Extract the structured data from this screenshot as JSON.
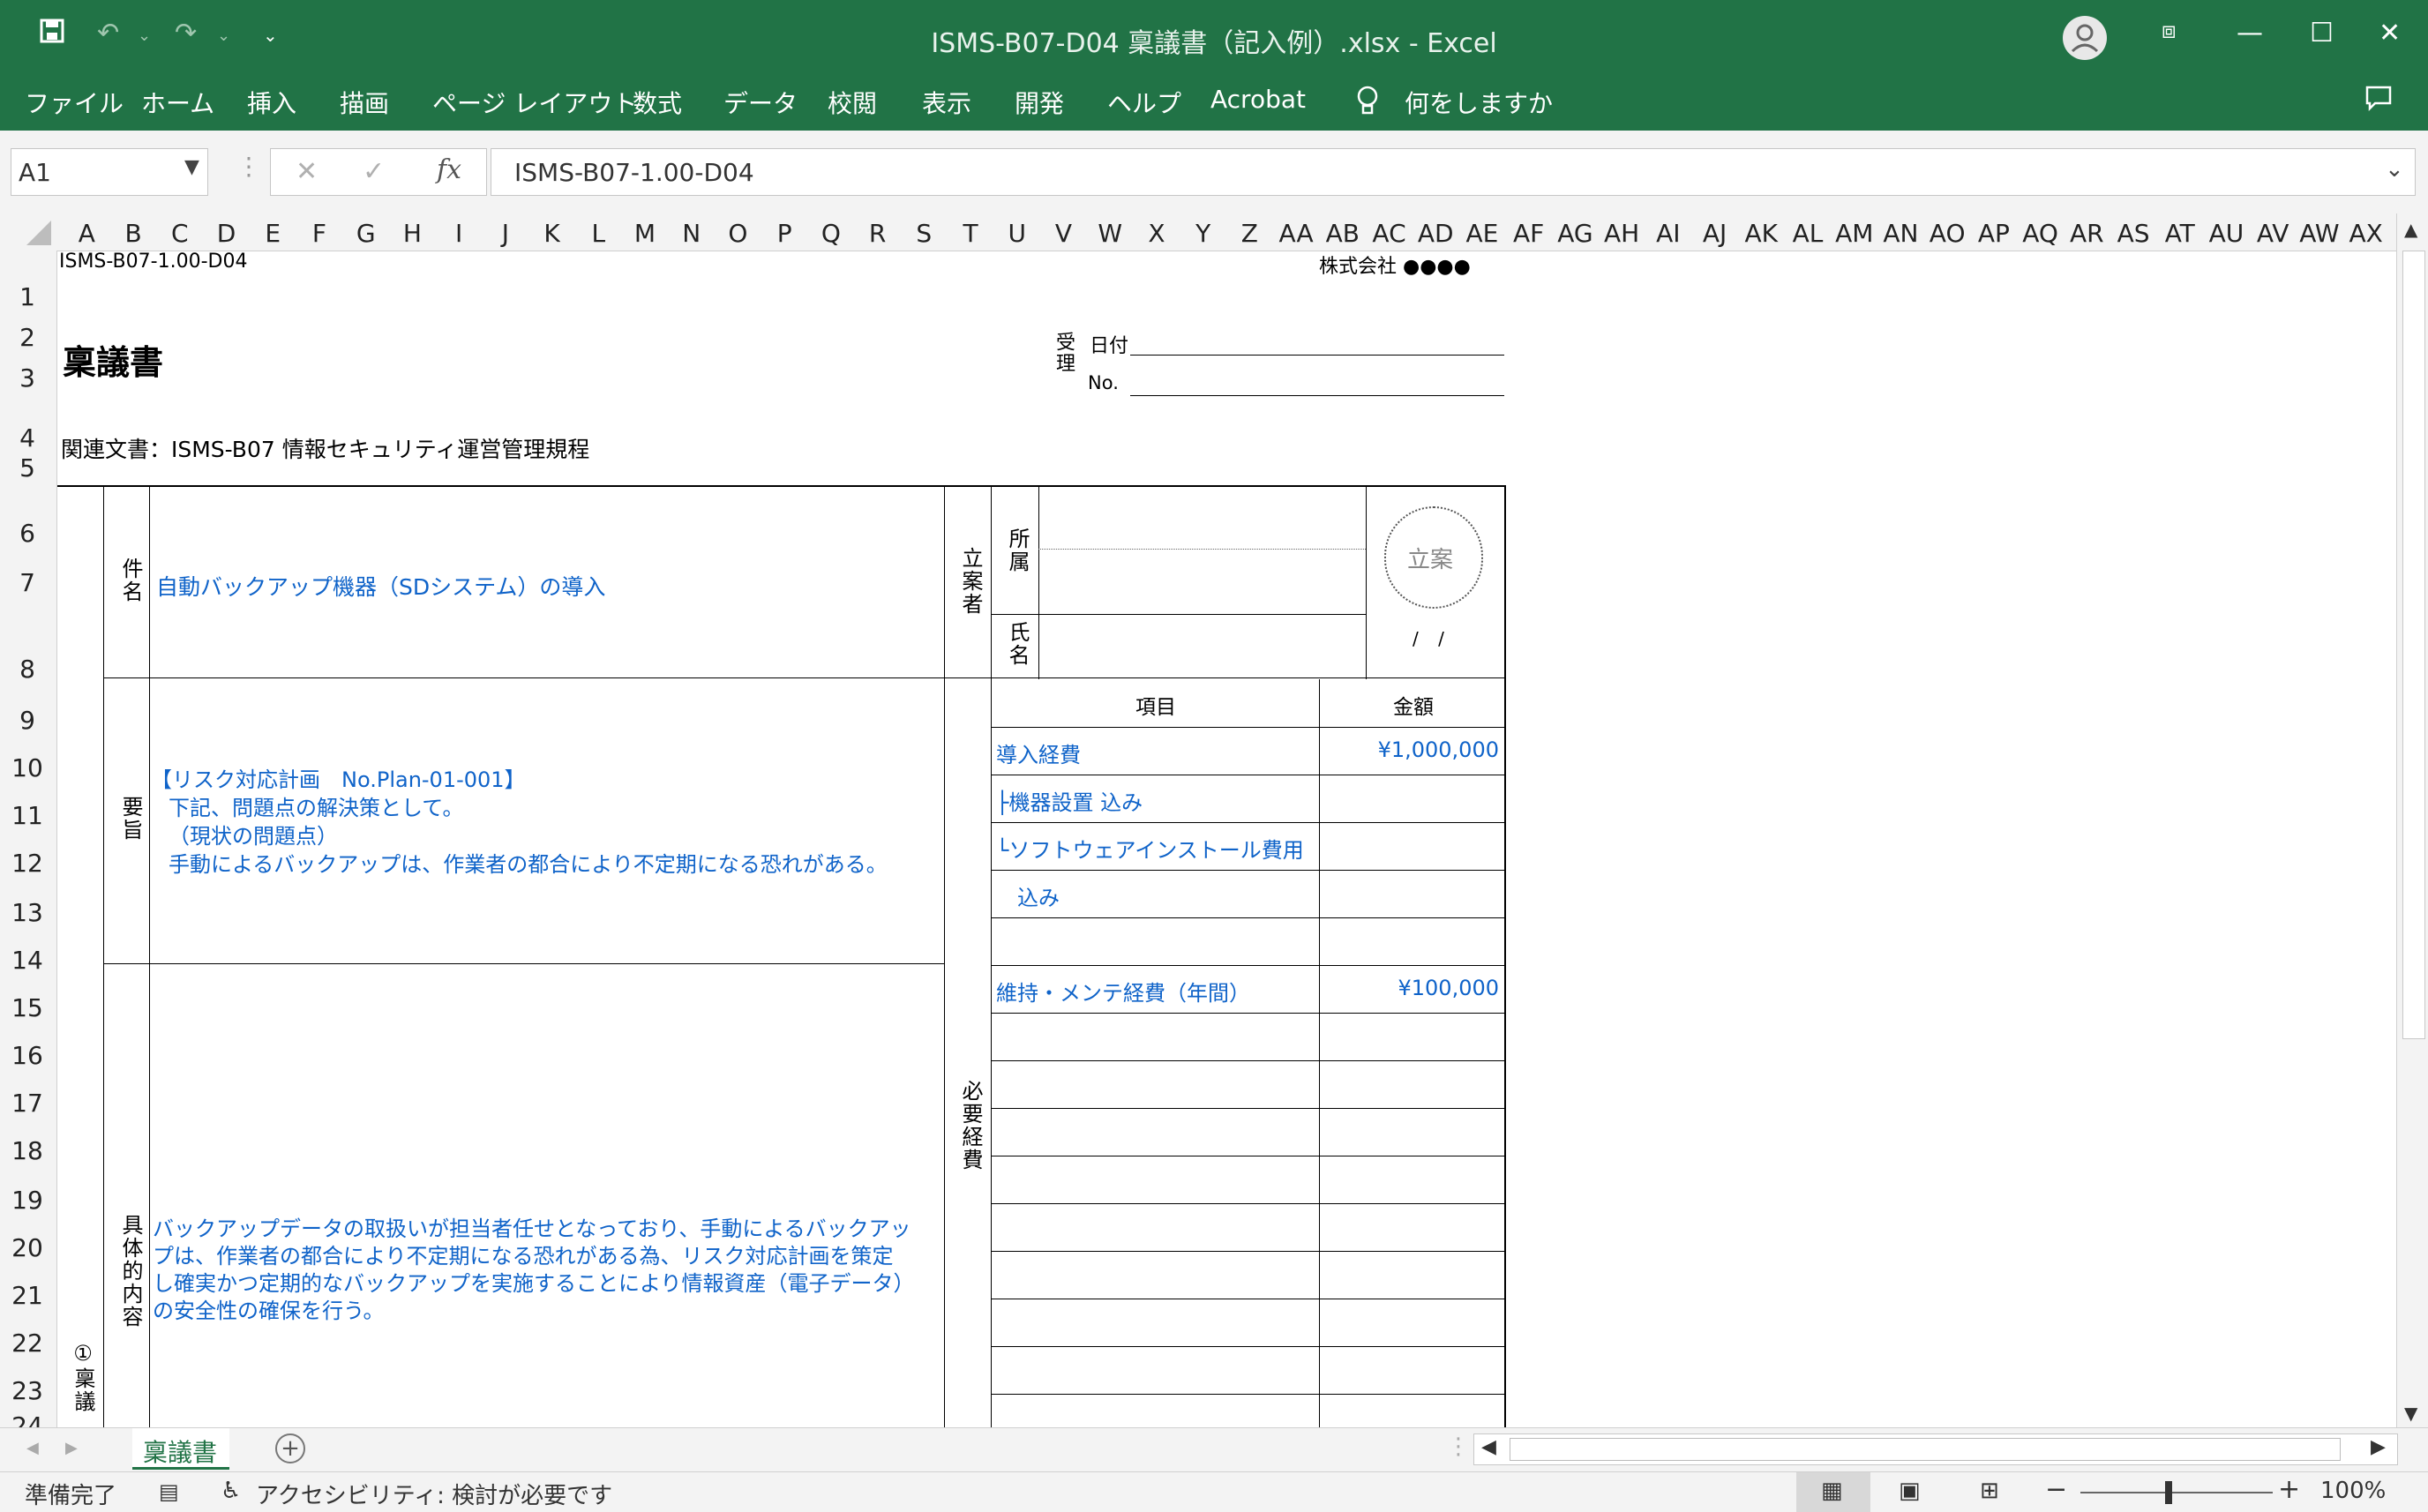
{
  "window": {
    "title": "ISMS-B07-D04 稟議書（記入例）.xlsx  -  Excel"
  },
  "ribbon": {
    "tabs": [
      "ファイル",
      "ホーム",
      "挿入",
      "描画",
      "ページ レイアウト",
      "数式",
      "データ",
      "校閲",
      "表示",
      "開発",
      "ヘルプ",
      "Acrobat"
    ],
    "tell_me": "何をしますか"
  },
  "formula_bar": {
    "name_box": "A1",
    "fx": "fx",
    "cancel": "✕",
    "enter": "✓",
    "value": "ISMS-B07-1.00-D04"
  },
  "columns": [
    "A",
    "B",
    "C",
    "D",
    "E",
    "F",
    "G",
    "H",
    "I",
    "J",
    "K",
    "L",
    "M",
    "N",
    "O",
    "P",
    "Q",
    "R",
    "S",
    "T",
    "U",
    "V",
    "W",
    "X",
    "Y",
    "Z",
    "AA",
    "AB",
    "AC",
    "AD",
    "AE",
    "AF",
    "AG",
    "AH",
    "AI",
    "AJ",
    "AK",
    "AL",
    "AM",
    "AN",
    "AO",
    "AP",
    "AQ",
    "AR",
    "AS",
    "AT",
    "AU",
    "AV",
    "AW",
    "AX"
  ],
  "rows": [
    "1",
    "2",
    "3",
    "4",
    "5",
    "6",
    "7",
    "8",
    "9",
    "10",
    "11",
    "12",
    "13",
    "14",
    "15",
    "16",
    "17",
    "18",
    "19",
    "20",
    "21",
    "22",
    "23",
    "24"
  ],
  "sheet": {
    "doc_id": "ISMS-B07-1.00-D04",
    "company": "株式会社 ●●●●",
    "title": "稟議書",
    "received_label": "受理",
    "date_label": "日付",
    "no_label": "No.",
    "related_doc": "関連文書：ISMS-B07 情報セキュリティ運営管理規程",
    "subject_label": "件名",
    "subject": "自動バックアップ機器（SDシステム）の導入",
    "proposer_label": "立案者",
    "dept_label": "所属",
    "name_label": "氏名",
    "stamp": "立案",
    "stamp_date": "/ /",
    "summary_label": "要旨",
    "summary": [
      "【リスク対応計画　No.Plan-01-001】",
      "下記、問題点の解決策として。",
      "（現状の問題点）",
      "手動によるバックアップは、作業者の都合により不定期になる恐れがある。"
    ],
    "cost_label": "必要経費",
    "item_header": "項目",
    "amount_header": "金額",
    "costs": [
      {
        "item": "導入経費",
        "amount": "¥1,000,000"
      },
      {
        "item": "├機器設置 込み",
        "amount": ""
      },
      {
        "item": "└ソフトウェアインストール費用",
        "amount": ""
      },
      {
        "item": "　込み",
        "amount": ""
      },
      {
        "item": "",
        "amount": ""
      },
      {
        "item": "維持・メンテ経費（年間）",
        "amount": "¥100,000"
      }
    ],
    "detail_label": "具体的内容",
    "detail": [
      "バックアップデータの取扱いが担当者任せとなっており、手動によるバックアッ",
      "プは、作業者の都合により不定期になる恐れがある為、リスク対応計画を策定",
      "し確実かつ定期的なバックアップを実施することにより情報資産（電子データ）",
      "の安全性の確保を行う。"
    ],
    "section_label": "①稟議"
  },
  "sheet_tabs": {
    "active": "稟議書"
  },
  "status": {
    "ready": "準備完了",
    "accessibility": "アクセシビリティ: 検討が必要です",
    "zoom": "100%"
  }
}
